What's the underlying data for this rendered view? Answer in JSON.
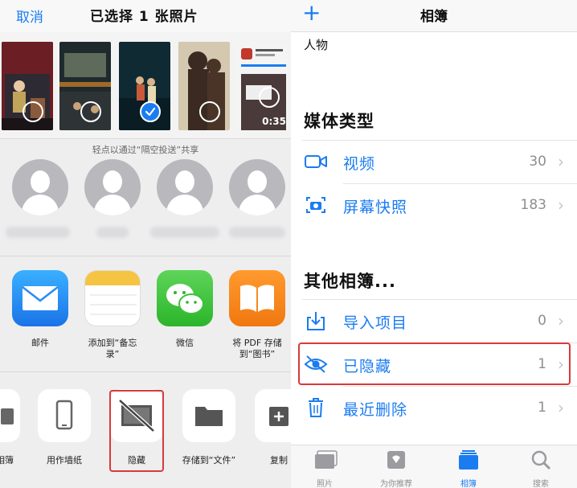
{
  "share_sheet": {
    "cancel_label": "取消",
    "title": "已选择 1 张照片",
    "photos": [
      {
        "selected": false,
        "duration": ""
      },
      {
        "selected": false,
        "duration": ""
      },
      {
        "selected": true,
        "duration": ""
      },
      {
        "selected": false,
        "duration": ""
      },
      {
        "selected": false,
        "duration": "0:35"
      }
    ],
    "airdrop_hint": "轻点以通过“隔空投送”共享",
    "apps": [
      {
        "label": "邮件",
        "icon": "mail-icon"
      },
      {
        "label": "添加到“备忘录”",
        "icon": "notes-icon"
      },
      {
        "label": "微信",
        "icon": "wechat-icon"
      },
      {
        "label": "将 PDF 存储到“图书”",
        "icon": "books-icon"
      }
    ],
    "actions": [
      {
        "label": "相簿",
        "icon": "album-icon"
      },
      {
        "label": "用作墙纸",
        "icon": "phone-icon"
      },
      {
        "label": "隐藏",
        "icon": "hide-icon"
      },
      {
        "label": "存储到“文件”",
        "icon": "folder-icon"
      },
      {
        "label": "复制",
        "icon": "copy-icon"
      }
    ]
  },
  "albums": {
    "title": "相簿",
    "people_label": "人物",
    "media_types_heading": "媒体类型",
    "media_types": [
      {
        "label": "视频",
        "count": "30",
        "icon": "video-icon"
      },
      {
        "label": "屏幕快照",
        "count": "183",
        "icon": "screenshot-icon"
      }
    ],
    "other_heading": "其他相簿...",
    "other": [
      {
        "label": "导入项目",
        "count": "0",
        "icon": "import-icon"
      },
      {
        "label": "已隐藏",
        "count": "1",
        "icon": "eye-slash-icon"
      },
      {
        "label": "最近删除",
        "count": "1",
        "icon": "trash-icon"
      }
    ]
  },
  "tabbar": {
    "tabs": [
      {
        "label": "照片",
        "icon": "photos-tab-icon",
        "active": false
      },
      {
        "label": "为你推荐",
        "icon": "for-you-tab-icon",
        "active": false
      },
      {
        "label": "相簿",
        "icon": "albums-tab-icon",
        "active": true
      },
      {
        "label": "搜索",
        "icon": "search-tab-icon",
        "active": false
      }
    ]
  },
  "colors": {
    "accent": "#1a7cf0",
    "highlight_box": "#d83a3a"
  }
}
